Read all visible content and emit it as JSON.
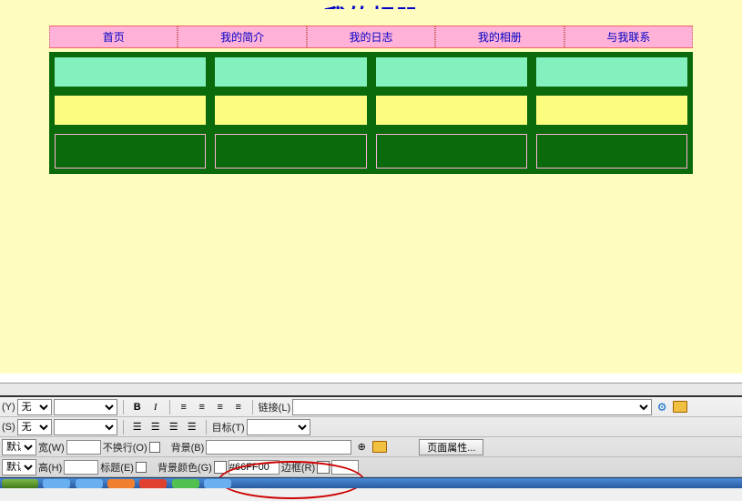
{
  "page_title": "我的相册",
  "nav": [
    "首页",
    "我的简介",
    "我的日志",
    "我的相册",
    "与我联系"
  ],
  "toolbar": {
    "row1": {
      "suffix1": "(Y)",
      "combo1": "无",
      "combo2": "",
      "b_label": "B",
      "i_label": "I",
      "link_label": "链接(L)"
    },
    "row2": {
      "suffix1": "(S)",
      "combo1": "无",
      "combo2": "",
      "target_label": "目标(T)"
    },
    "row3": {
      "default_label": "默认",
      "width_label": "宽(W)",
      "nowrap_label": "不换行(O)",
      "bg_label": "背景(B)",
      "props_label": "页面属性..."
    },
    "row4": {
      "default_label": "默认",
      "height_label": "高(H)",
      "title_label": "标题(E)",
      "bgcolor_label": "背景颜色(G)",
      "color_value": "#66FF00",
      "border_label": "边框(R)"
    }
  }
}
